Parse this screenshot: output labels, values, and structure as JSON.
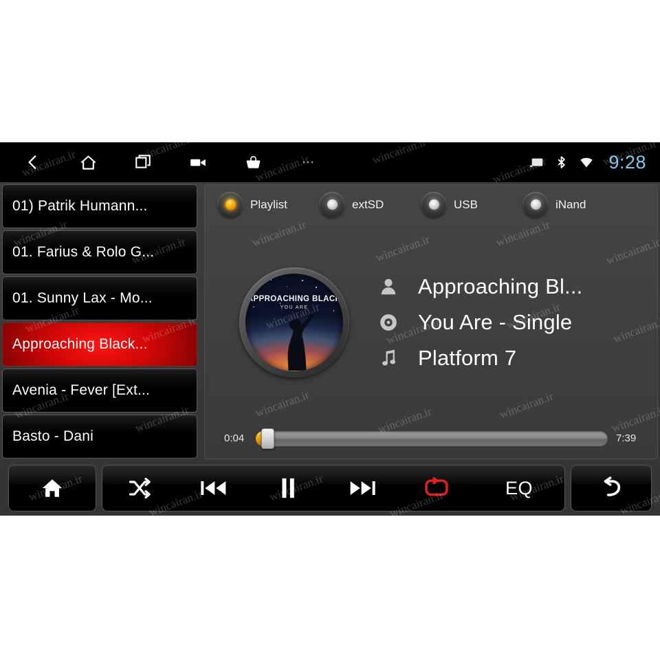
{
  "statusbar": {
    "nav": [
      {
        "name": "back-icon",
        "label": "Back"
      },
      {
        "name": "home-icon",
        "label": "Home"
      },
      {
        "name": "recents-icon",
        "label": "Recent apps"
      },
      {
        "name": "video-camera-icon",
        "label": "Screen record"
      },
      {
        "name": "shopping-bag-icon",
        "label": "Apps"
      },
      {
        "name": "more-icon",
        "label": "..."
      }
    ],
    "system": [
      {
        "name": "cast-icon",
        "label": "Cast"
      },
      {
        "name": "bluetooth-icon",
        "label": "Bluetooth"
      },
      {
        "name": "wifi-icon",
        "label": "Wi-Fi"
      }
    ],
    "clock": "9:28",
    "clock_color": "#7ec8ef"
  },
  "playlist": {
    "items": [
      {
        "label": "01) Patrik Humann...",
        "selected": false
      },
      {
        "label": "01. Farius & Rolo G...",
        "selected": false
      },
      {
        "label": "01. Sunny Lax - Mo...",
        "selected": false
      },
      {
        "label": "Approaching Black...",
        "selected": true
      },
      {
        "label": "Avenia - Fever [Ext...",
        "selected": false
      },
      {
        "label": "Basto - Dani",
        "selected": false
      }
    ],
    "selected_color": "#d00707"
  },
  "sources": {
    "options": [
      {
        "label": "Playlist",
        "active": true
      },
      {
        "label": "extSD",
        "active": false
      },
      {
        "label": "USB",
        "active": false
      },
      {
        "label": "iNand",
        "active": false
      }
    ],
    "active_led_color": "#ffb400"
  },
  "now_playing": {
    "album_art": {
      "title": "APPROACHING BLACK",
      "subtitle": "YOU ARE"
    },
    "artist": "Approaching Bl...",
    "album": "You Are - Single",
    "track": "Platform 7"
  },
  "progress": {
    "elapsed": "0:04",
    "total": "7:39",
    "percent": 1,
    "fill_color": "#e9a200"
  },
  "controls": {
    "home": {
      "label": "Home",
      "icon": "home-icon"
    },
    "transport": [
      {
        "label": "Shuffle",
        "icon": "shuffle-icon",
        "active": false
      },
      {
        "label": "Previous",
        "icon": "previous-icon",
        "active": false
      },
      {
        "label": "Pause",
        "icon": "pause-icon",
        "active": false
      },
      {
        "label": "Next",
        "icon": "next-icon",
        "active": false
      },
      {
        "label": "Repeat",
        "icon": "repeat-icon",
        "active": true
      },
      {
        "label": "EQ",
        "icon": "eq-text",
        "active": false
      }
    ],
    "eq_label": "EQ",
    "back": {
      "label": "Back",
      "icon": "return-arrow-icon"
    },
    "active_color": "#e02020"
  },
  "watermark": {
    "text": "wincairan.ir"
  }
}
